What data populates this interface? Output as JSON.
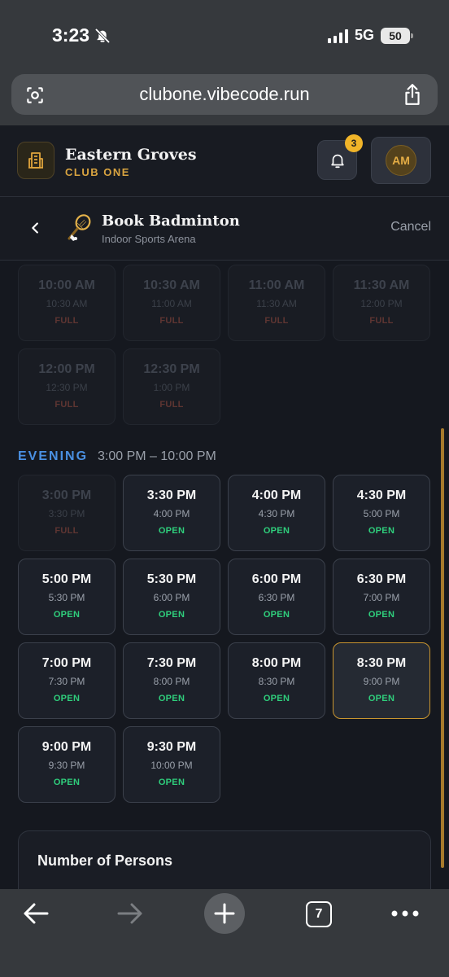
{
  "status_bar": {
    "time": "3:23",
    "network": "5G",
    "battery": "50",
    "icons": {
      "silent": "bell-slash-icon",
      "signal": "signal-icon"
    }
  },
  "browser": {
    "url": "clubone.vibecode.run",
    "icons": {
      "left": "page-tools-icon",
      "right": "share-icon"
    }
  },
  "header": {
    "club_name": "Eastern Groves",
    "club_sub": "CLUB ONE",
    "notification_count": "3",
    "avatar_initials": "AM",
    "icons": {
      "logo": "building-icon",
      "notifications": "bell-icon"
    }
  },
  "sub_header": {
    "title": "Book Badminton",
    "subtitle": "Indoor Sports Arena",
    "cancel_label": "Cancel",
    "icons": {
      "back": "chevron-left-icon",
      "sport": "badminton-racket-icon"
    }
  },
  "afternoon_slots": [
    {
      "start": "10:00 AM",
      "end": "10:30 AM",
      "status": "FULL"
    },
    {
      "start": "10:30 AM",
      "end": "11:00 AM",
      "status": "FULL"
    },
    {
      "start": "11:00 AM",
      "end": "11:30 AM",
      "status": "FULL"
    },
    {
      "start": "11:30 AM",
      "end": "12:00 PM",
      "status": "FULL"
    },
    {
      "start": "12:00 PM",
      "end": "12:30 PM",
      "status": "FULL"
    },
    {
      "start": "12:30 PM",
      "end": "1:00 PM",
      "status": "FULL"
    }
  ],
  "evening": {
    "label": "EVENING",
    "range": "3:00 PM – 10:00 PM",
    "slots": [
      {
        "start": "3:00 PM",
        "end": "3:30 PM",
        "status": "FULL"
      },
      {
        "start": "3:30 PM",
        "end": "4:00 PM",
        "status": "OPEN"
      },
      {
        "start": "4:00 PM",
        "end": "4:30 PM",
        "status": "OPEN"
      },
      {
        "start": "4:30 PM",
        "end": "5:00 PM",
        "status": "OPEN"
      },
      {
        "start": "5:00 PM",
        "end": "5:30 PM",
        "status": "OPEN"
      },
      {
        "start": "5:30 PM",
        "end": "6:00 PM",
        "status": "OPEN"
      },
      {
        "start": "6:00 PM",
        "end": "6:30 PM",
        "status": "OPEN"
      },
      {
        "start": "6:30 PM",
        "end": "7:00 PM",
        "status": "OPEN"
      },
      {
        "start": "7:00 PM",
        "end": "7:30 PM",
        "status": "OPEN"
      },
      {
        "start": "7:30 PM",
        "end": "8:00 PM",
        "status": "OPEN"
      },
      {
        "start": "8:00 PM",
        "end": "8:30 PM",
        "status": "OPEN"
      },
      {
        "start": "8:30 PM",
        "end": "9:00 PM",
        "status": "OPEN",
        "selected": true
      },
      {
        "start": "9:00 PM",
        "end": "9:30 PM",
        "status": "OPEN"
      },
      {
        "start": "9:30 PM",
        "end": "10:00 PM",
        "status": "OPEN"
      }
    ]
  },
  "persons": {
    "title": "Number of Persons"
  },
  "toolbar": {
    "tab_count": "7",
    "icons": {
      "back": "arrow-left-icon",
      "forward": "arrow-right-icon",
      "new_tab": "plus-icon",
      "tabs": "tabs-icon",
      "more": "more-icon"
    }
  },
  "colors": {
    "accent_gold": "#d9a440",
    "open_green": "#2fce7c",
    "full_red": "#5e3532",
    "section_blue": "#4a90e2",
    "background": "#15181f"
  }
}
